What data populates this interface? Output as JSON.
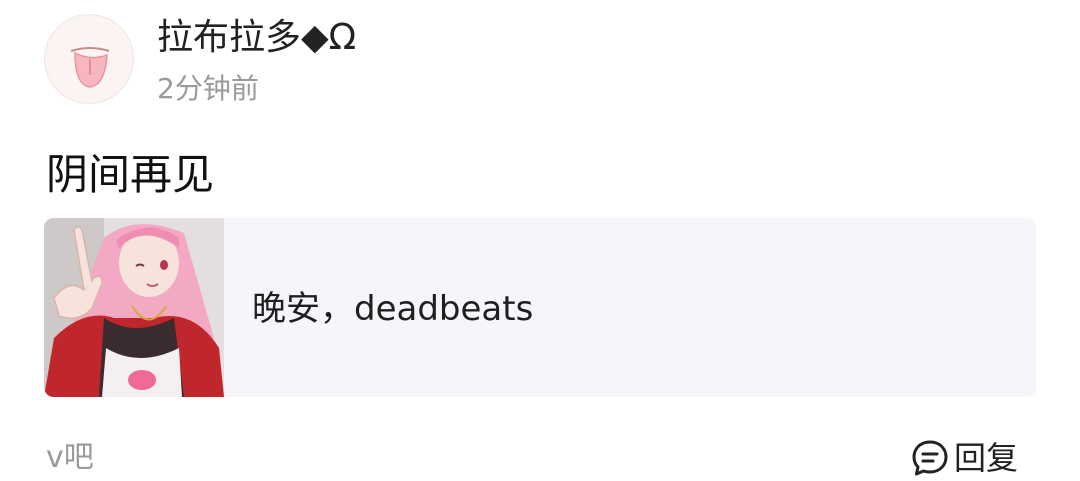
{
  "post": {
    "author": {
      "name": "拉布拉多◆Ω",
      "avatar_icon": "tongue-avatar-icon"
    },
    "timestamp": "2分钟前",
    "title": "阴间再见",
    "share_card": {
      "text": "晚安，deadbeats",
      "thumbnail_desc": "pink-haired-anime-girl-pointing"
    },
    "footer": {
      "forum": "v吧",
      "reply_label": "回复",
      "reply_icon": "comment-bubble-icon"
    }
  },
  "colors": {
    "card_background": "#f5f5fa",
    "muted_text": "#9a9a9a",
    "primary_text": "#1a1a1a",
    "hair_pink": "#f3a9c4",
    "jacket_red": "#c0272d"
  }
}
